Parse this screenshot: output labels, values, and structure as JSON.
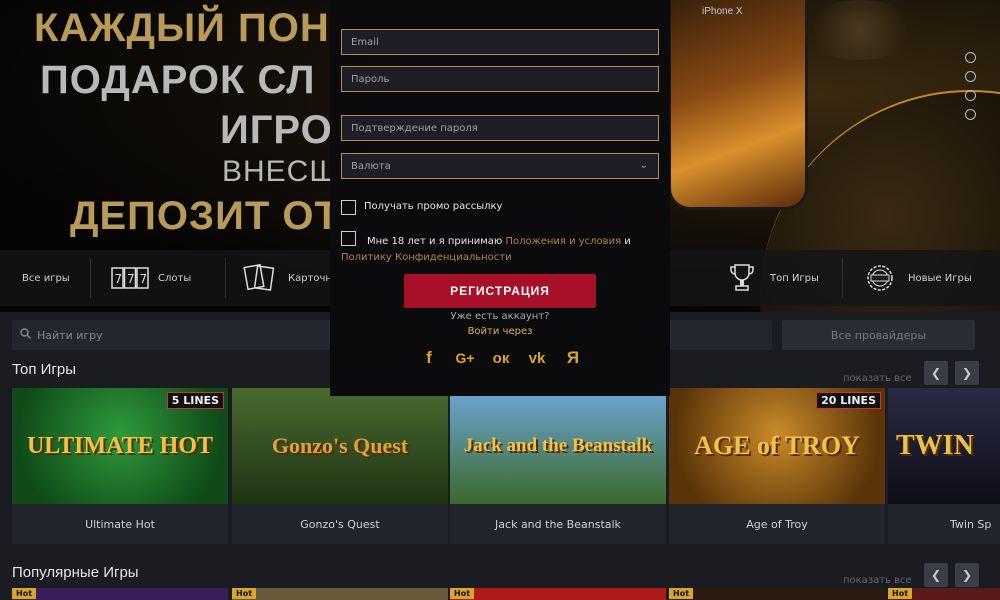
{
  "hero": {
    "line1": "КАЖДЫЙ ПОН",
    "line2": "ПОДАРОК СЛ",
    "line3": "ИГРО",
    "line4": "ВНЕСШ",
    "line5": "ДЕПОЗИТ ОТ",
    "phone_label": "iPhone X"
  },
  "categories": [
    {
      "label": "Все игры",
      "icon": "all-games-icon"
    },
    {
      "label": "Слоты",
      "icon": "slots-icon"
    },
    {
      "label": "Карточн",
      "icon": "cards-icon"
    },
    {
      "label": "Топ Игры",
      "icon": "trophy-icon"
    },
    {
      "label": "Новые Игры",
      "icon": "new-badge-icon"
    }
  ],
  "search": {
    "placeholder": "Найти игру"
  },
  "providers": {
    "label": "Все провайдеры"
  },
  "sections": {
    "top": {
      "title": "Топ Игры",
      "show_all": "показать все"
    },
    "popular": {
      "title": "Популярные Игры",
      "show_all": "показать все"
    }
  },
  "top_games": [
    {
      "name": "Ultimate Hot",
      "thumb": "ULTIMATE HOT",
      "badge": "5 LINES",
      "bg": "#1c6e2c"
    },
    {
      "name": "Gonzo's Quest",
      "thumb": "Gonzo's Quest",
      "badge": "",
      "bg": "#2d4a20"
    },
    {
      "name": "Jack and the Beanstalk",
      "thumb": "Jack and the Beanstalk",
      "badge": "",
      "bg": "#3b6fa0"
    },
    {
      "name": "Age of Troy",
      "thumb": "AGE of TROY",
      "badge": "20 LINES",
      "bg": "#8a5a14"
    },
    {
      "name": "Twin Sp",
      "thumb": "TWIN",
      "badge": "",
      "bg": "#1c1c2a"
    }
  ],
  "popular_badges": [
    "Hot",
    "Hot",
    "Hot",
    "Hot",
    "Hot"
  ],
  "modal": {
    "email_placeholder": "Email",
    "password_placeholder": "Пароль",
    "confirm_placeholder": "Подтверждение пароля",
    "currency_placeholder": "Валюта",
    "promo_label": "Получать промо рассылку",
    "terms_prefix": "Мне 18 лет и я принимаю",
    "terms_link": "Положения и условия",
    "terms_and": "и",
    "privacy_link": "Политику Конфиденциальности",
    "register_button": "РЕГИСТРАЦИЯ",
    "have_account": "Уже есть аккаунт?",
    "login_via": "Войти через",
    "socials": [
      {
        "label": "f",
        "icon": "facebook-icon"
      },
      {
        "label": "G+",
        "icon": "google-plus-icon"
      },
      {
        "label": "ок",
        "icon": "odnoklassniki-icon"
      },
      {
        "label": "vk",
        "icon": "vk-icon"
      },
      {
        "label": "Я",
        "icon": "yandex-icon"
      }
    ]
  }
}
